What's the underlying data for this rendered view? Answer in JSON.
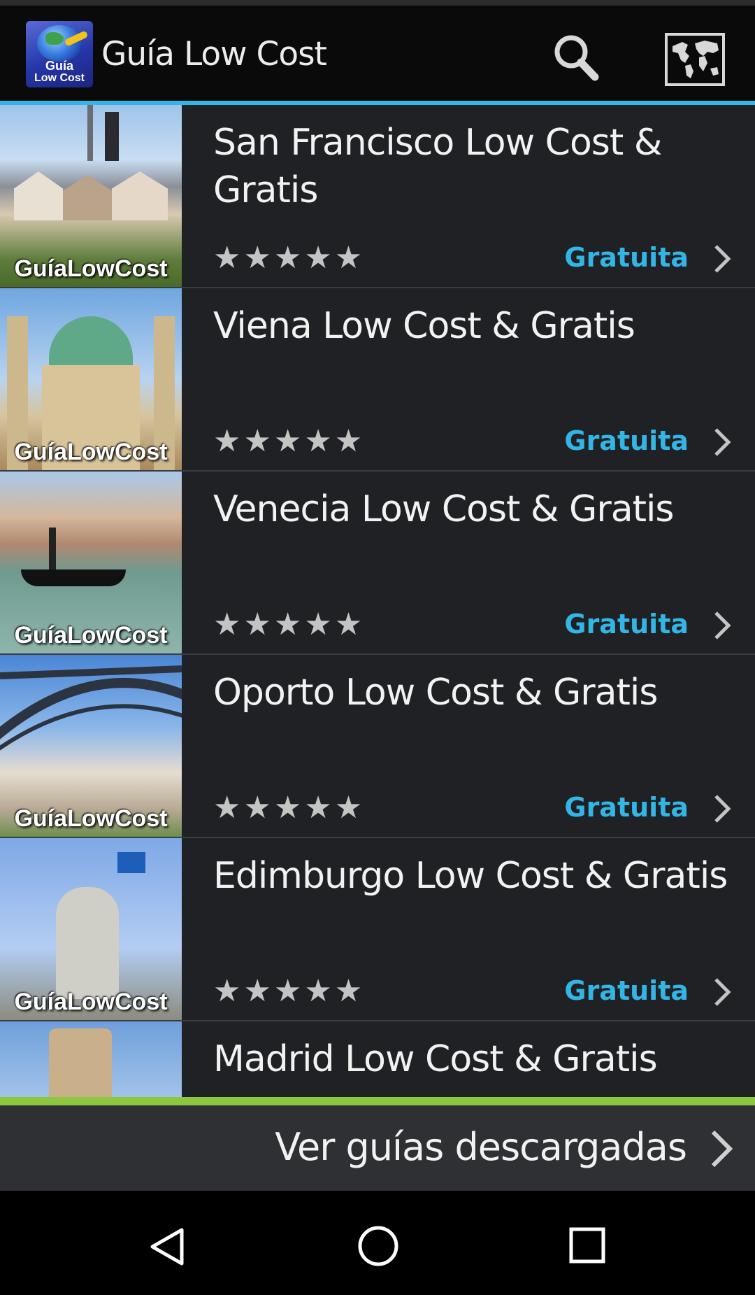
{
  "app": {
    "title": "Guía Low Cost",
    "logo_line1": "Guía",
    "logo_line2": "Low Cost"
  },
  "toolbar": {
    "search_icon": "search-icon",
    "map_icon": "world-map-icon"
  },
  "colors": {
    "accent": "#33b5e5",
    "footer_accent": "#8dc63f",
    "background": "#1f2125"
  },
  "guides": [
    {
      "title": "San Francisco Low Cost & Gratis",
      "brand": "GuíaLowCost",
      "stars": "★★★★★",
      "price": "Gratuita"
    },
    {
      "title": "Viena Low Cost & Gratis",
      "brand": "GuíaLowCost",
      "stars": "★★★★★",
      "price": "Gratuita"
    },
    {
      "title": "Venecia Low Cost & Gratis",
      "brand": "GuíaLowCost",
      "stars": "★★★★★",
      "price": "Gratuita"
    },
    {
      "title": "Oporto Low Cost & Gratis",
      "brand": "GuíaLowCost",
      "stars": "★★★★★",
      "price": "Gratuita"
    },
    {
      "title": "Edimburgo Low Cost & Gratis",
      "brand": "GuíaLowCost",
      "stars": "★★★★★",
      "price": "Gratuita"
    },
    {
      "title": "Madrid Low Cost & Gratis"
    }
  ],
  "footer": {
    "label": "Ver guías descargadas"
  },
  "navigation": {
    "back_icon": "back-icon",
    "home_icon": "home-icon",
    "recents_icon": "recents-icon"
  }
}
